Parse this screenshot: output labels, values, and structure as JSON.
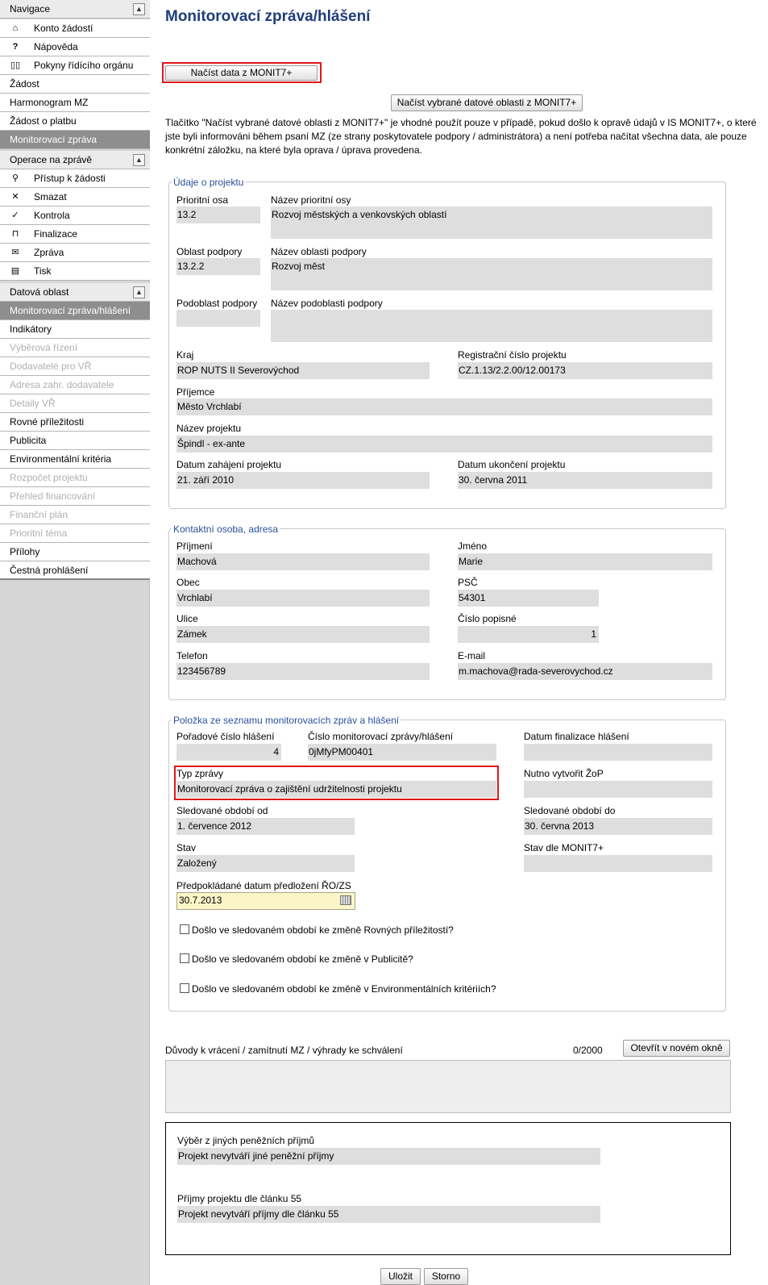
{
  "sidebar": {
    "nav_header": "Navigace",
    "nav_items": [
      {
        "icon": "home-icon",
        "glyph": "⌂",
        "label": "Konto žádostí"
      },
      {
        "icon": "help-icon",
        "glyph": "?",
        "label": "Nápověda"
      },
      {
        "icon": "book-icon",
        "glyph": "📖",
        "label": "Pokyny řídícího orgánu"
      }
    ],
    "plain_items": [
      "Žádost",
      "Harmonogram MZ",
      "Žádost o platbu"
    ],
    "active_section": "Monitorovací zpráva",
    "ops_header": "Operace na zprávě",
    "ops_items": [
      {
        "icon": "user-icon",
        "glyph": "👤",
        "label": "Přístup k žádosti"
      },
      {
        "icon": "delete-icon",
        "glyph": "✕",
        "label": "Smazat"
      },
      {
        "icon": "check-icon",
        "glyph": "✓",
        "label": "Kontrola"
      },
      {
        "icon": "lock-icon",
        "glyph": "🔒",
        "label": "Finalizace"
      },
      {
        "icon": "mail-icon",
        "glyph": "✉",
        "label": "Zpráva"
      },
      {
        "icon": "print-icon",
        "glyph": "▤",
        "label": "Tisk"
      }
    ],
    "data_header": "Datová oblast",
    "data_active": "Monitorovací zpráva/hlášení",
    "data_items": [
      {
        "label": "Indikátory",
        "enabled": true
      },
      {
        "label": "Výběrová řízení",
        "enabled": false
      },
      {
        "label": "Dodavatelé pro VŘ",
        "enabled": false
      },
      {
        "label": "Adresa zahr. dodavatele",
        "enabled": false
      },
      {
        "label": "Detaily VŘ",
        "enabled": false
      },
      {
        "label": "Rovné příležitosti",
        "enabled": true
      },
      {
        "label": "Publicita",
        "enabled": true
      },
      {
        "label": "Environmentální kritéria",
        "enabled": true
      },
      {
        "label": "Rozpočet projektu",
        "enabled": false
      },
      {
        "label": "Přehled financování",
        "enabled": false
      },
      {
        "label": "Finanční plán",
        "enabled": false
      },
      {
        "label": "Prioritní téma",
        "enabled": false
      },
      {
        "label": "Přílohy",
        "enabled": true
      },
      {
        "label": "Čestná prohlášení",
        "enabled": true
      }
    ]
  },
  "page": {
    "title": "Monitorovací zpráva/hlášení",
    "btn_load_all": "Načíst data z MONIT7+",
    "btn_load_selected": "Načíst vybrané datové oblasti z MONIT7+",
    "intro_text": "Tlačítko \"Načíst vybrané datové oblasti z MONIT7+\" je vhodné použít pouze v případě, pokud došlo k opravě údajů v IS MONIT7+, o které jste byli informováni během psaní MZ (ze strany poskytovatele podpory / administrátora) a není potřeba načítat všechna data, ale pouze konkrétní záložku, na které byla oprava / úprava provedena."
  },
  "project": {
    "legend": "Údaje o projektu",
    "prioritni_osa_label": "Prioritní osa",
    "prioritni_osa": "13.2",
    "nazev_osy_label": "Název prioritní osy",
    "nazev_osy": "Rozvoj městských a venkovských oblastí",
    "oblast_label": "Oblast podpory",
    "oblast": "13.2.2",
    "nazev_oblasti_label": "Název oblasti podpory",
    "nazev_oblasti": "Rozvoj měst",
    "podoblast_label": "Podoblast podpory",
    "podoblast": "",
    "nazev_podoblasti_label": "Název podoblasti podpory",
    "nazev_podoblasti": "",
    "kraj_label": "Kraj",
    "kraj": "ROP NUTS II Severovýchod",
    "reg_cislo_label": "Registrační číslo projektu",
    "reg_cislo": "CZ.1.13/2.2.00/12.00173",
    "prijemce_label": "Příjemce",
    "prijemce": "Město Vrchlabí",
    "nazev_label": "Název projektu",
    "nazev": "Špindl - ex-ante",
    "zahajeni_label": "Datum zahájení projektu",
    "zahajeni": "21. září 2010",
    "ukonceni_label": "Datum ukončení projektu",
    "ukonceni": "30. června 2011"
  },
  "contact": {
    "legend": "Kontaktní osoba, adresa",
    "prijmeni_label": "Příjmení",
    "prijmeni": "Machová",
    "jmeno_label": "Jméno",
    "jmeno": "Marie",
    "obec_label": "Obec",
    "obec": "Vrchlabí",
    "psc_label": "PSČ",
    "psc": "54301",
    "ulice_label": "Ulice",
    "ulice": "Zámek",
    "cislo_label": "Číslo popisné",
    "cislo": "1",
    "telefon_label": "Telefon",
    "telefon": "123456789",
    "email_label": "E-mail",
    "email": "m.machova@rada-severovychod.cz"
  },
  "report": {
    "legend": "Položka ze seznamu monitorovacích zpráv a hlášení",
    "poradove_label": "Pořadové číslo hlášení",
    "poradove": "4",
    "cislo_mz_label": "Číslo monitorovací zprávy/hlášení",
    "cislo_mz": "0jMfyPM00401",
    "datum_final_label": "Datum finalizace hlášení",
    "datum_final": "",
    "typ_label": "Typ zprávy",
    "typ": "Monitorovací zpráva o zajištění udržitelnosti projektu",
    "nutno_zop_label": "Nutno vytvořit ŽoP",
    "nutno_zop": "",
    "obdobi_od_label": "Sledované období od",
    "obdobi_od": "1. července 2012",
    "obdobi_do_label": "Sledované období do",
    "obdobi_do": "30. června 2013",
    "stav_label": "Stav",
    "stav": "Založený",
    "stav_monit_label": "Stav dle MONIT7+",
    "stav_monit": "",
    "predpoklad_label": "Předpokládané datum předložení ŘO/ZS",
    "predpoklad": "30.7.2013",
    "chk_rovne": "Došlo ve sledovaném období ke změně Rovných příležitostí?",
    "chk_publicita": "Došlo ve sledovaném období ke změně v Publicitě?",
    "chk_env": "Došlo ve sledovaném období ke změně v Environmentálních kritériích?"
  },
  "reasons": {
    "label": "Důvody k vrácení / zamítnutí MZ / výhrady ke schválení",
    "counter": "0/2000",
    "open_btn": "Otevřít v novém okně"
  },
  "income": {
    "jine_label": "Výběr z jiných peněžních příjmů",
    "jine": "Projekt nevytváří jiné peněžní příjmy",
    "cl55_label": "Příjmy projektu dle článku 55",
    "cl55": "Projekt nevytváří příjmy dle článku 55"
  },
  "footer": {
    "save": "Uložit",
    "cancel": "Storno"
  }
}
